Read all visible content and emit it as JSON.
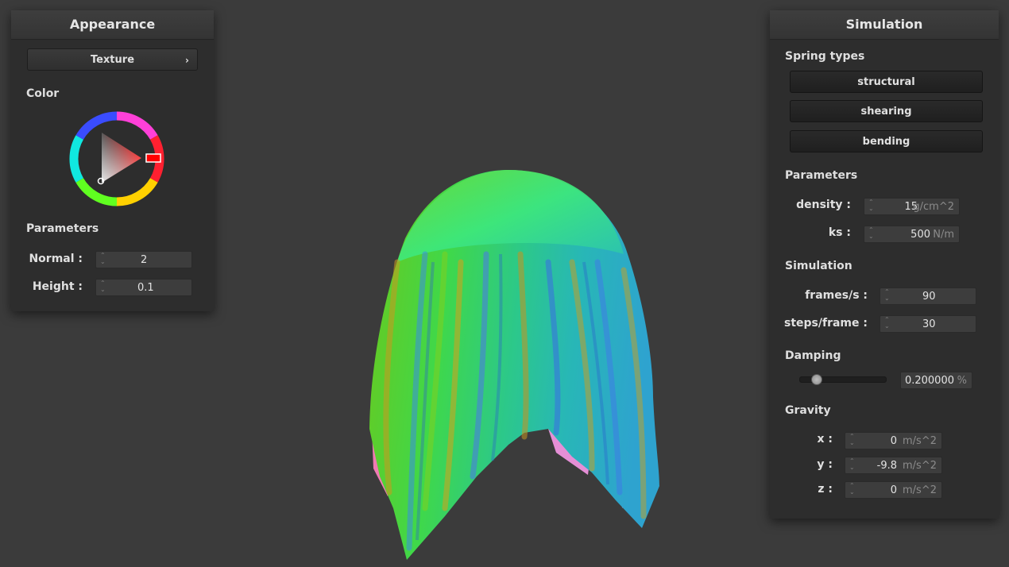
{
  "appearance": {
    "title": "Appearance",
    "texture_button": "Texture",
    "color_label": "Color",
    "parameters_label": "Parameters",
    "normal": {
      "label": "Normal :",
      "value": "2"
    },
    "height": {
      "label": "Height :",
      "value": "0.1"
    }
  },
  "simulation": {
    "title": "Simulation",
    "spring_types_label": "Spring types",
    "springs": [
      "structural",
      "shearing",
      "bending"
    ],
    "parameters_label": "Parameters",
    "density": {
      "label": "density :",
      "value": "15",
      "unit": "g/cm^2"
    },
    "ks": {
      "label": "ks :",
      "value": "500",
      "unit": "N/m"
    },
    "sim_label": "Simulation",
    "fps": {
      "label": "frames/s :",
      "value": "90"
    },
    "steps": {
      "label": "steps/frame :",
      "value": "30"
    },
    "damping_label": "Damping",
    "damping": {
      "value": "0.200000",
      "unit": "%",
      "slider_fraction": 0.2
    },
    "gravity_label": "Gravity",
    "gravity": {
      "x": {
        "label": "x :",
        "value": "0",
        "unit": "m/s^2"
      },
      "y": {
        "label": "y :",
        "value": "-9.8",
        "unit": "m/s^2"
      },
      "z": {
        "label": "z :",
        "value": "0",
        "unit": "m/s^2"
      }
    }
  },
  "colors": {
    "background": "#3b3b3b",
    "panel": "#2d2d2d",
    "selected_hue": "#ff0000"
  }
}
